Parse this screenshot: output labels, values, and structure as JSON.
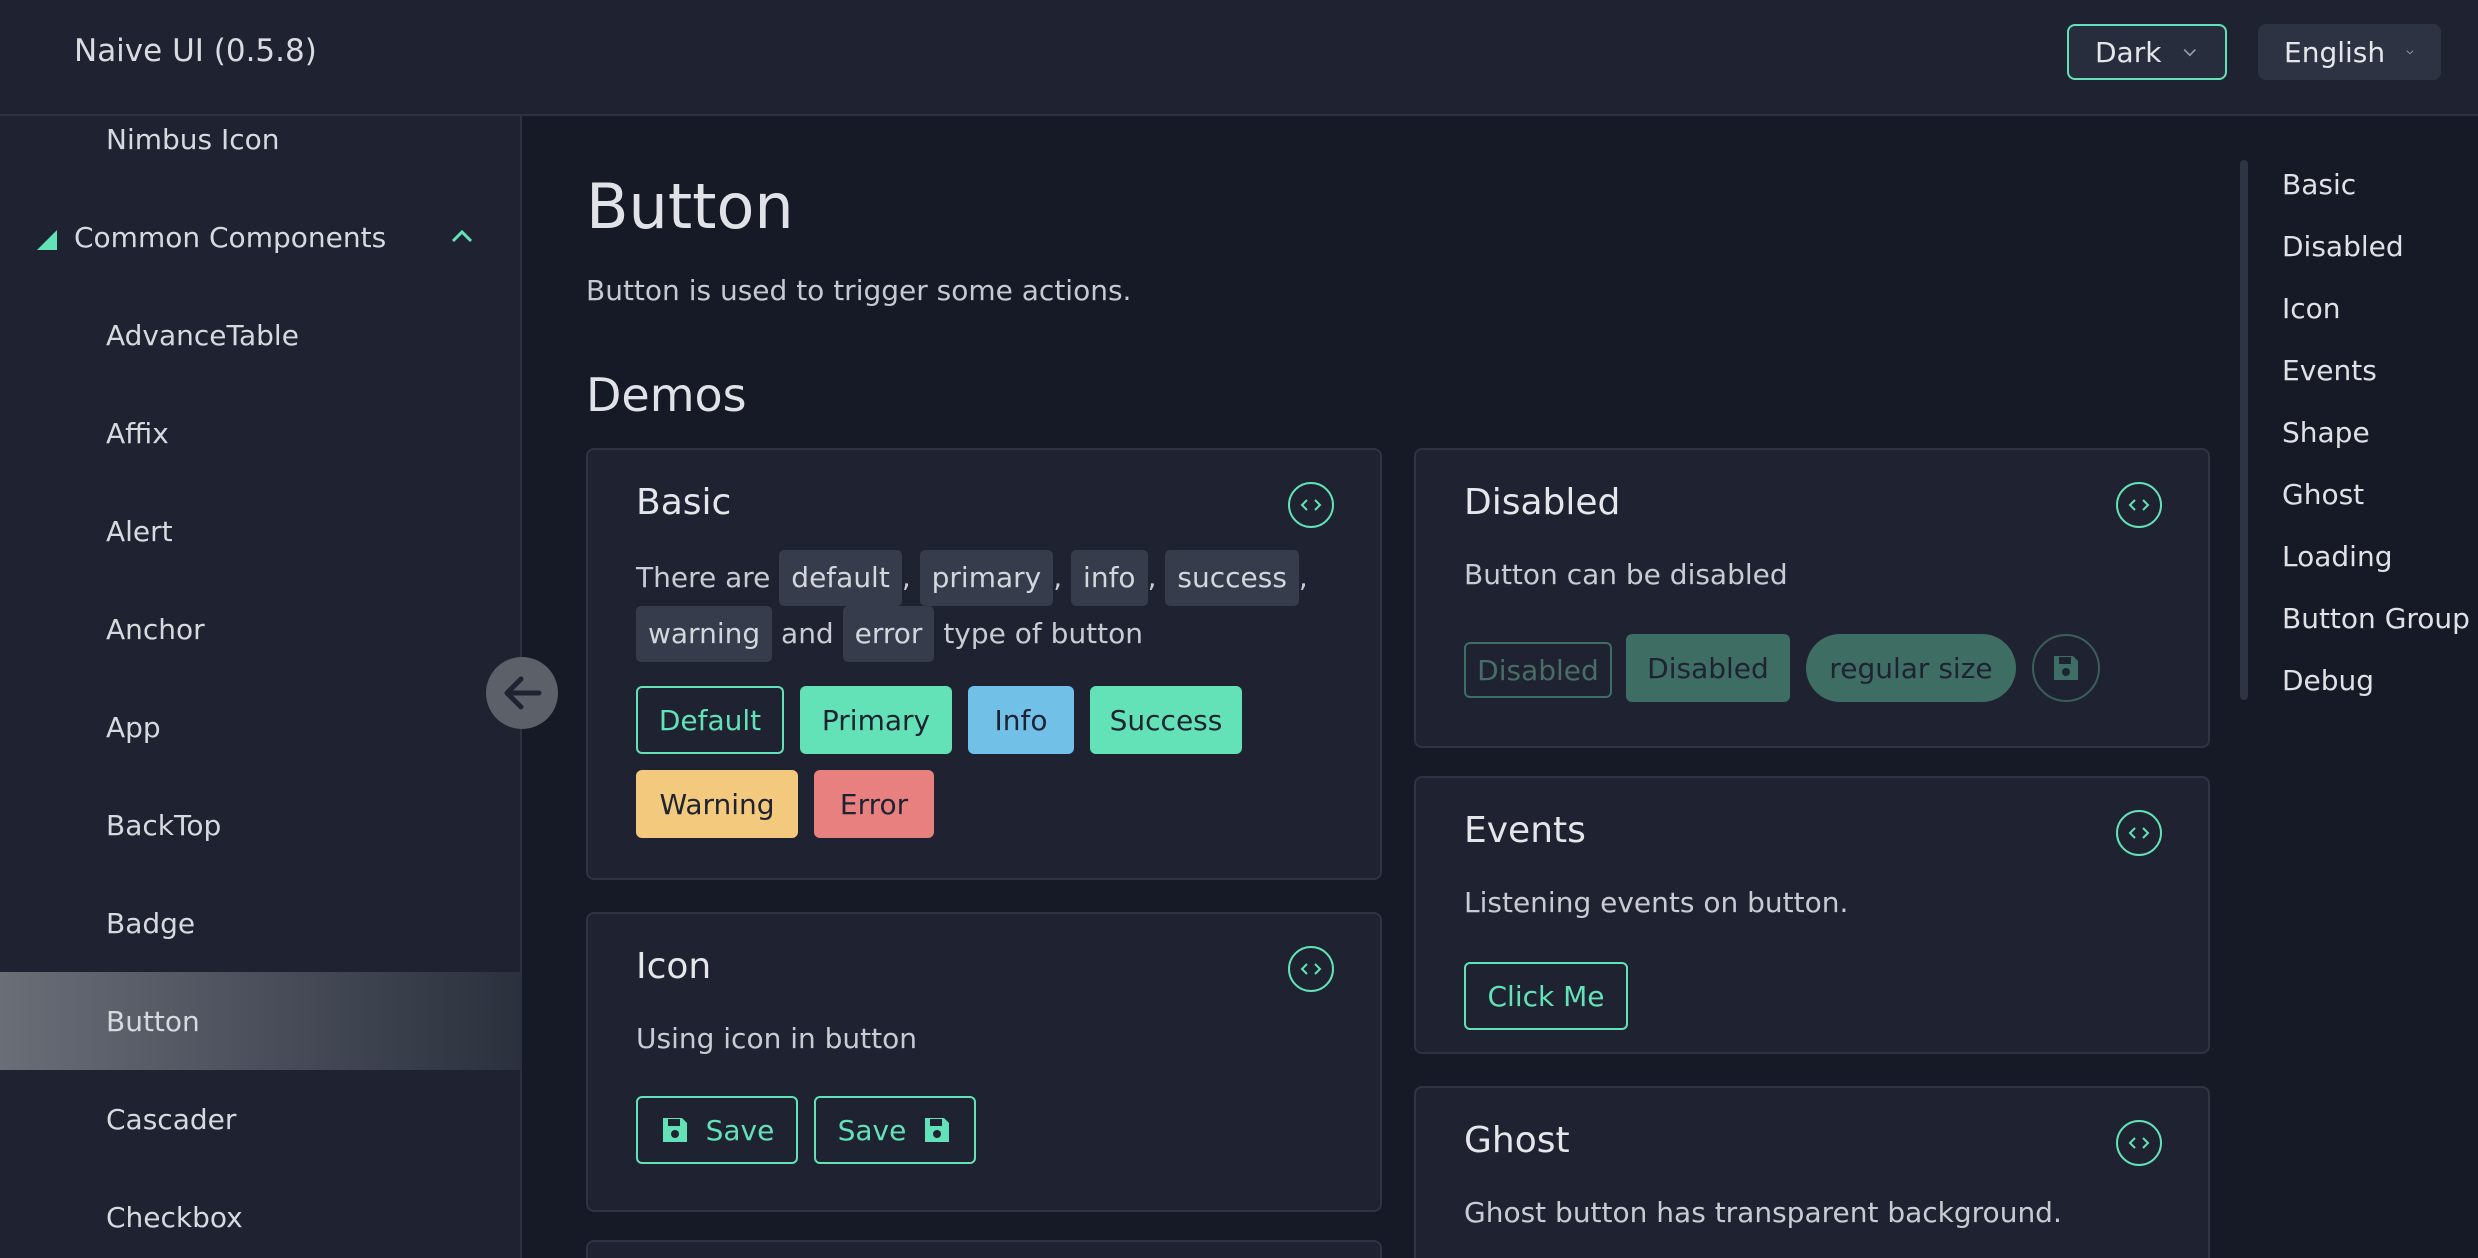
{
  "header": {
    "title": "Naive UI (0.5.8)",
    "theme_select": "Dark",
    "lang_select": "English"
  },
  "sidebar": {
    "items": [
      {
        "label": "Nimbus Icon"
      },
      {
        "label": "Common Components",
        "group": true
      },
      {
        "label": "AdvanceTable"
      },
      {
        "label": "Affix"
      },
      {
        "label": "Alert"
      },
      {
        "label": "Anchor"
      },
      {
        "label": "App"
      },
      {
        "label": "BackTop"
      },
      {
        "label": "Badge"
      },
      {
        "label": "Button",
        "active": true
      },
      {
        "label": "Cascader"
      },
      {
        "label": "Checkbox"
      }
    ]
  },
  "page": {
    "title": "Button",
    "description": "Button is used to trigger some actions.",
    "demos_heading": "Demos"
  },
  "cards": {
    "basic": {
      "title": "Basic",
      "desc_1": "There are",
      "tags": [
        "default",
        "primary",
        "info",
        "success",
        "warning",
        "error"
      ],
      "sep": ",",
      "and": "and",
      "desc_2": "type of button",
      "buttons": [
        "Default",
        "Primary",
        "Info",
        "Success",
        "Warning",
        "Error"
      ]
    },
    "disabled": {
      "title": "Disabled",
      "desc": "Button can be disabled",
      "buttons": [
        "Disabled",
        "Disabled",
        "regular size"
      ]
    },
    "icon": {
      "title": "Icon",
      "desc": "Using icon in button",
      "buttons": [
        "Save",
        "Save"
      ]
    },
    "events": {
      "title": "Events",
      "desc": "Listening events on button.",
      "button": "Click Me"
    },
    "ghost": {
      "title": "Ghost",
      "desc": "Ghost button has transparent background."
    }
  },
  "toc": [
    "Basic",
    "Disabled",
    "Icon",
    "Events",
    "Shape",
    "Ghost",
    "Loading",
    "Button Group",
    "Debug"
  ],
  "colors": {
    "accent": "#63e2b7",
    "info": "#70c0e8",
    "warning": "#f2c97d",
    "error": "#e88080",
    "bg": "#151a26",
    "card": "#1f2331"
  }
}
